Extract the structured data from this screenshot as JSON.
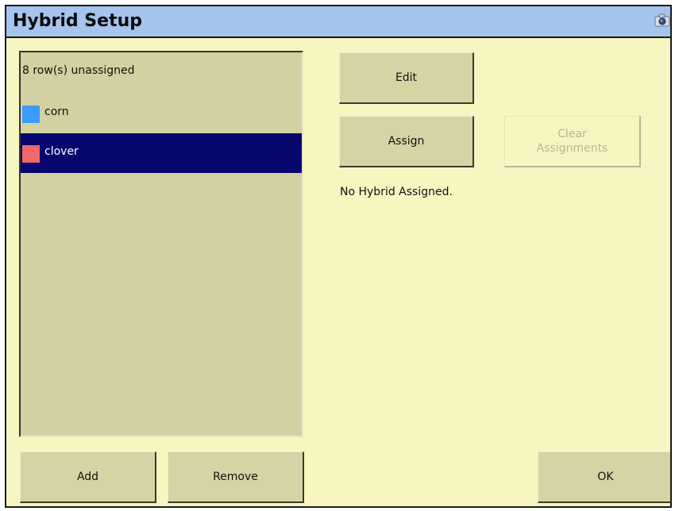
{
  "window": {
    "title": "Hybrid Setup"
  },
  "icons": {
    "titlebar": "camera-icon"
  },
  "list": {
    "header": "8 row(s) unassigned",
    "items": [
      {
        "label": "corn",
        "color": "#3a9bff",
        "selected": false
      },
      {
        "label": "clover",
        "color": "#f06868",
        "selected": true
      }
    ]
  },
  "buttons": {
    "edit": "Edit",
    "assign": "Assign",
    "clear_line1": "Clear",
    "clear_line2": "Assignments",
    "add": "Add",
    "remove": "Remove",
    "ok": "OK"
  },
  "status": {
    "message": "No Hybrid Assigned."
  },
  "colors": {
    "background": "#f8f6c0",
    "titlebar": "#a5c4ee",
    "list_bg": "#d3d1a1",
    "selection": "#06066e"
  }
}
